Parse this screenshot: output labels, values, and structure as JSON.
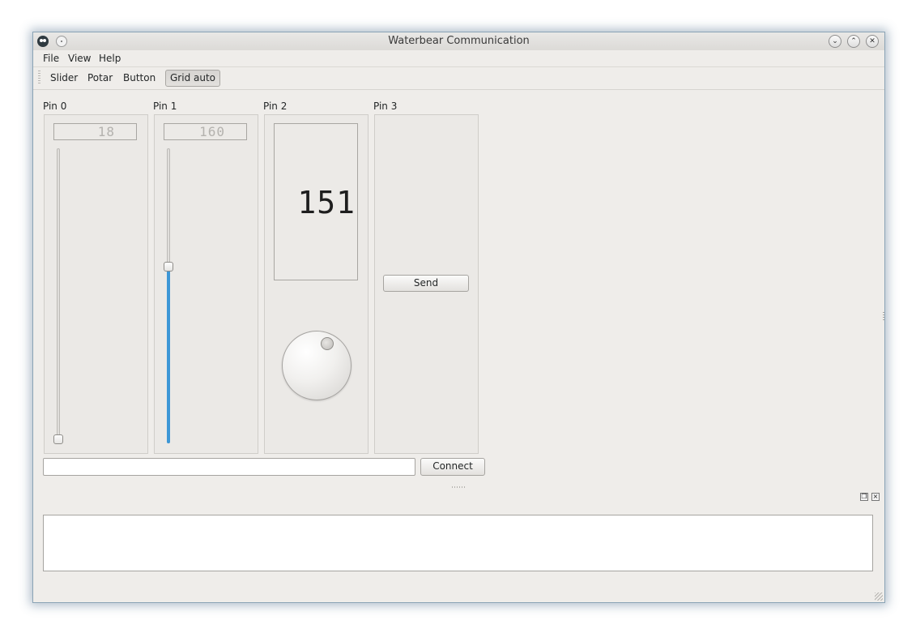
{
  "window": {
    "title": "Waterbear Communication"
  },
  "menubar": {
    "items": [
      "File",
      "View",
      "Help"
    ]
  },
  "toolbar": {
    "items": [
      "Slider",
      "Potar",
      "Button",
      "Grid auto"
    ],
    "active": "Grid auto"
  },
  "pins": [
    {
      "label": "Pin 0",
      "widget": "slider",
      "display_value": "18",
      "level": 0.0
    },
    {
      "label": "Pin 1",
      "widget": "slider",
      "display_value": "160",
      "level": 0.63
    },
    {
      "label": "Pin 2",
      "widget": "potar",
      "display_value": "151"
    },
    {
      "label": "Pin 3",
      "widget": "button",
      "button_label": "Send"
    }
  ],
  "connection": {
    "address_value": "",
    "connect_label": "Connect"
  },
  "log": {
    "content": ""
  },
  "colors": {
    "accent": "#3d97d6",
    "background": "#efedea",
    "window_border": "#8aa3b5"
  }
}
